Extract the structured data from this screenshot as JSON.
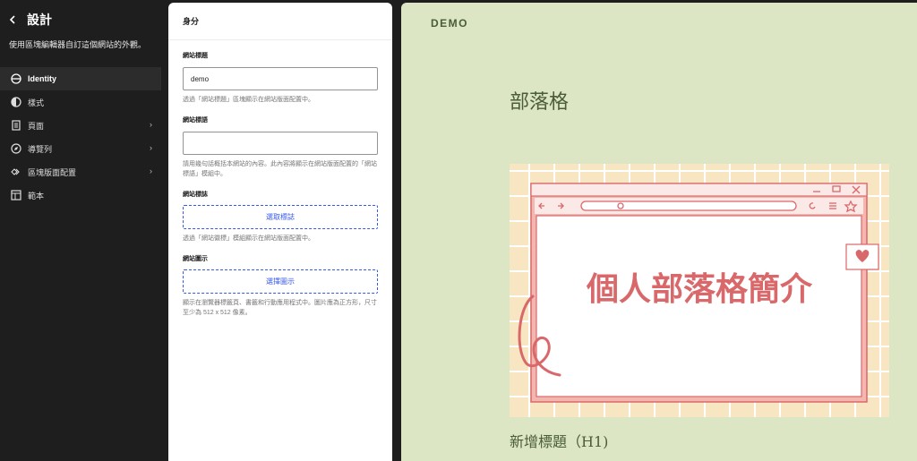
{
  "sidebar": {
    "title": "設計",
    "description": "使用區塊編輯器自訂這個網站的外觀。",
    "items": [
      {
        "label": "Identity",
        "icon": "identity-icon",
        "active": true
      },
      {
        "label": "樣式",
        "icon": "styles-icon"
      },
      {
        "label": "頁面",
        "icon": "page-icon"
      },
      {
        "label": "導覽列",
        "icon": "navigation-icon"
      },
      {
        "label": "區塊版面配置",
        "icon": "patterns-icon"
      },
      {
        "label": "範本",
        "icon": "template-icon"
      }
    ]
  },
  "panel": {
    "title": "身分",
    "site_title_label": "網站標題",
    "site_title_value": "demo",
    "site_title_help": "透過「網站標題」區塊顯示在網站版面配置中。",
    "tagline_label": "網站標語",
    "tagline_value": "",
    "tagline_help": "請用幾句話概括本網站的內容。此內容將顯示在網站版面配置的「網站標語」模組中。",
    "logo_label": "網站標誌",
    "logo_button": "選取標誌",
    "logo_help": "透過「網站徽標」模組顯示在網站版面配置中。",
    "icon_label": "網站圖示",
    "icon_button": "選擇圖示",
    "icon_help": "顯示在瀏覽器標籤頁、書籤和行動應用程式中。圖片應為正方形，尺寸至少為 512 x 512 像素。"
  },
  "preview": {
    "site_title": "DEMO",
    "heading": "部落格",
    "hero_text": "個人部落格簡介",
    "h1_text": "新增標題（H1)",
    "colors": {
      "bg": "#dce6c5",
      "text": "#4b5c3a",
      "hero_pink": "#d9686a",
      "hero_cream": "#f8e6c2"
    }
  }
}
